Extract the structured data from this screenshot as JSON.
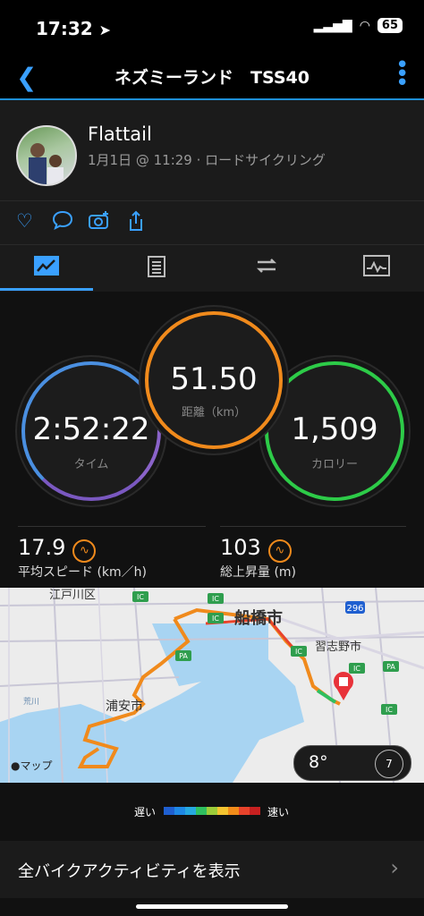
{
  "status_bar": {
    "time": "17:32",
    "battery": "65"
  },
  "header": {
    "title": "ネズミーランド　TSS40"
  },
  "profile": {
    "name": "Flattail",
    "subtitle": "1月1日 @ 11:29 · ロードサイクリング"
  },
  "stats": {
    "distance": {
      "value": "51.50",
      "label": "距離（km）"
    },
    "time": {
      "value": "2:52:22",
      "label": "タイム"
    },
    "calories": {
      "value": "1,509",
      "label": "カロリー"
    },
    "avg_speed": {
      "value": "17.9",
      "label": "平均スピード (km／h)"
    },
    "elevation": {
      "value": "103",
      "label": "総上昇量 (m)"
    }
  },
  "map": {
    "labels": [
      "江戸川区",
      "船橋市",
      "習志野市",
      "浦安市",
      "荒川"
    ],
    "road_badge": "296",
    "ic": "IC",
    "pa": "PA",
    "attribution": "マップ",
    "weather": {
      "temp": "8°",
      "wind": "7"
    }
  },
  "legend": {
    "slow": "遅い",
    "fast": "速い",
    "colors": [
      "#1f5fd0",
      "#1e88e5",
      "#26a9e0",
      "#2fbf60",
      "#9ccc3a",
      "#f4c430",
      "#f28c1a",
      "#e8432b",
      "#c72020"
    ]
  },
  "all_bike": {
    "label": "全バイクアクティビティを表示"
  },
  "colors": {
    "accent": "#3aa0ff",
    "orange": "#f08a1c",
    "green": "#2dcb48",
    "purple": "#7a58c0"
  }
}
